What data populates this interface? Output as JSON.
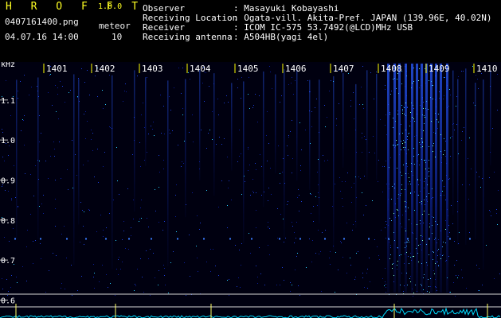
{
  "header": {
    "brand": "H R O F F T",
    "version": "1.0.0",
    "filename": "0407161400.png",
    "meteor_label": "meteor",
    "datetime": "04.07.16 14:00",
    "meteor_count": "10"
  },
  "info": {
    "rows": [
      {
        "label": "Observer",
        "value": ": Masayuki Kobayashi"
      },
      {
        "label": "Receiving Location",
        "value": ": Ogata-vill. Akita-Pref. JAPAN (139.96E, 40.02N)"
      },
      {
        "label": "Receiver",
        "value": ": ICOM IC-575 53.7492(@LCD)MHz USB"
      },
      {
        "label": "Receiving antenna",
        "value": ": A504HB(yagi 4el)"
      }
    ]
  },
  "spectrogram": {
    "y_unit": "kHz",
    "y_ticks": [
      {
        "label": "1.1",
        "value": 1.1
      },
      {
        "label": "1.0",
        "value": 1.0
      },
      {
        "label": "0.9",
        "value": 0.9
      },
      {
        "label": "0.8",
        "value": 0.8
      },
      {
        "label": "0.7",
        "value": 0.7
      },
      {
        "label": "0.6",
        "value": 0.6
      }
    ],
    "y_range": [
      0.585,
      1.185
    ],
    "time_labels": [
      "1401",
      "1402",
      "1403",
      "1404",
      "1405",
      "1406",
      "1407",
      "1408",
      "1409",
      "1410"
    ],
    "colors": {
      "tick": "#ffff00",
      "line": "#ffff66",
      "background": "#000000",
      "trace": "#00ddff"
    }
  }
}
